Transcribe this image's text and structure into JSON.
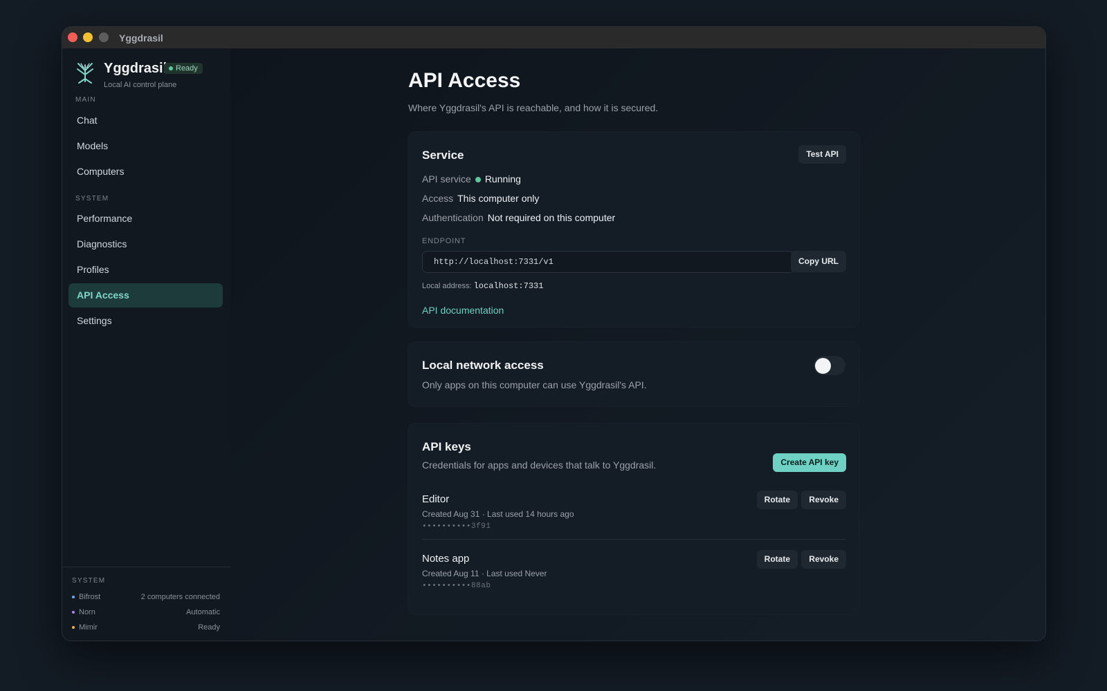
{
  "window": {
    "title": "Yggdrasil"
  },
  "sidebar": {
    "app_name": "Yggdrasil",
    "status_badge": "Ready",
    "subtitle": "Local AI control plane",
    "sections": [
      {
        "label": "MAIN",
        "items": [
          {
            "label": "Chat"
          },
          {
            "label": "Models"
          },
          {
            "label": "Computers"
          }
        ]
      },
      {
        "label": "SYSTEM",
        "items": [
          {
            "label": "Performance"
          },
          {
            "label": "Diagnostics"
          },
          {
            "label": "Profiles"
          },
          {
            "label": "API Access"
          },
          {
            "label": "Settings"
          }
        ]
      }
    ],
    "active_item": "API Access",
    "footer": {
      "label": "SYSTEM",
      "rows": [
        {
          "name": "Bifrost",
          "value": "2 computers connected",
          "color": "#7aa7e8"
        },
        {
          "name": "Norn",
          "value": "Automatic",
          "color": "#a78be8"
        },
        {
          "name": "Mimir",
          "value": "Ready",
          "color": "#e8b45a"
        }
      ]
    }
  },
  "page": {
    "title": "API Access",
    "subtitle": "Where Yggdrasil's API is reachable, and how it is secured."
  },
  "service": {
    "title": "Service",
    "test_button": "Test API",
    "rows": [
      {
        "key": "API service",
        "value": "Running",
        "status_color": "#5ec79d"
      },
      {
        "key": "Access",
        "value": "This computer only"
      },
      {
        "key": "Authentication",
        "value": "Not required on this computer"
      }
    ],
    "endpoint_label": "ENDPOINT",
    "endpoint_url": "http://localhost:7331/v1",
    "copy_button": "Copy URL",
    "local_address_label": "Local address:",
    "local_address": "localhost:7331",
    "docs_link": "API documentation"
  },
  "network": {
    "title": "Local network access",
    "description": "Only apps on this computer can use Yggdrasil's API.",
    "enabled": false
  },
  "api_keys": {
    "title": "API keys",
    "description": "Credentials for apps and devices that talk to Yggdrasil.",
    "create_button": "Create API key",
    "keys": [
      {
        "name": "Editor",
        "meta": "Created Aug 31 · Last used 14 hours ago",
        "masked": "••••••••••3f91",
        "rotate": "Rotate",
        "revoke": "Revoke"
      },
      {
        "name": "Notes app",
        "meta": "Created Aug 11 · Last used Never",
        "masked": "••••••••••88ab",
        "rotate": "Rotate",
        "revoke": "Revoke"
      }
    ]
  },
  "colors": {
    "accent": "#6fd1c3",
    "running": "#5ec79d",
    "background": "#131b24"
  }
}
